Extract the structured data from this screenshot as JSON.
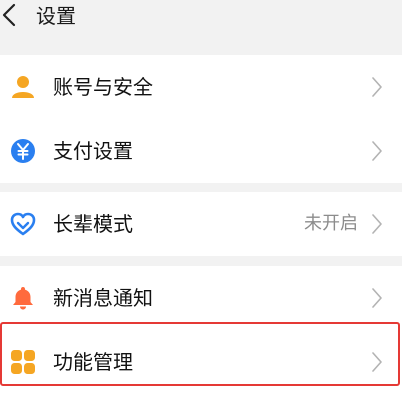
{
  "header": {
    "title": "设置"
  },
  "groups": [
    {
      "items": [
        {
          "label": "账号与安全",
          "icon": "user-icon"
        },
        {
          "label": "支付设置",
          "icon": "yuan-icon"
        }
      ]
    },
    {
      "items": [
        {
          "label": "长辈模式",
          "value": "未开启",
          "icon": "heart-shield-icon"
        }
      ]
    },
    {
      "items": [
        {
          "label": "新消息通知",
          "icon": "bell-icon"
        },
        {
          "label": "功能管理",
          "icon": "grid-icon"
        }
      ]
    }
  ],
  "colors": {
    "accent": "#f5a623",
    "blue": "#2a7ff0",
    "highlight": "#e53935",
    "background": "#f2f2f2"
  }
}
